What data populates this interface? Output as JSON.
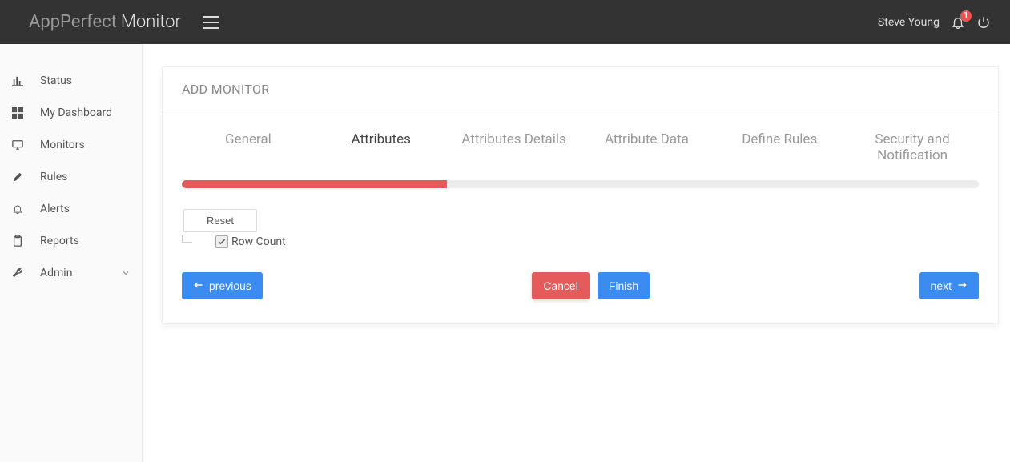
{
  "header": {
    "brand_light": "AppPerfect",
    "brand_bold": "Monitor",
    "user": "Steve Young",
    "notification_count": "1"
  },
  "sidebar": {
    "items": [
      {
        "label": "Status"
      },
      {
        "label": "My Dashboard"
      },
      {
        "label": "Monitors"
      },
      {
        "label": "Rules"
      },
      {
        "label": "Alerts"
      },
      {
        "label": "Reports"
      },
      {
        "label": "Admin"
      }
    ]
  },
  "card": {
    "title": "ADD MONITOR",
    "wizard_tabs": [
      "General",
      "Attributes",
      "Attributes Details",
      "Attribute Data",
      "Define Rules",
      "Security and Notification"
    ],
    "active_tab_index": 1,
    "progress": {
      "fill_color": "#e55a5a",
      "percent": 33.3
    },
    "reset_label": "Reset",
    "tree_item_label": "Row Count",
    "tree_item_checked": true,
    "buttons": {
      "previous": "previous",
      "cancel": "Cancel",
      "finish": "Finish",
      "next": "next"
    }
  }
}
